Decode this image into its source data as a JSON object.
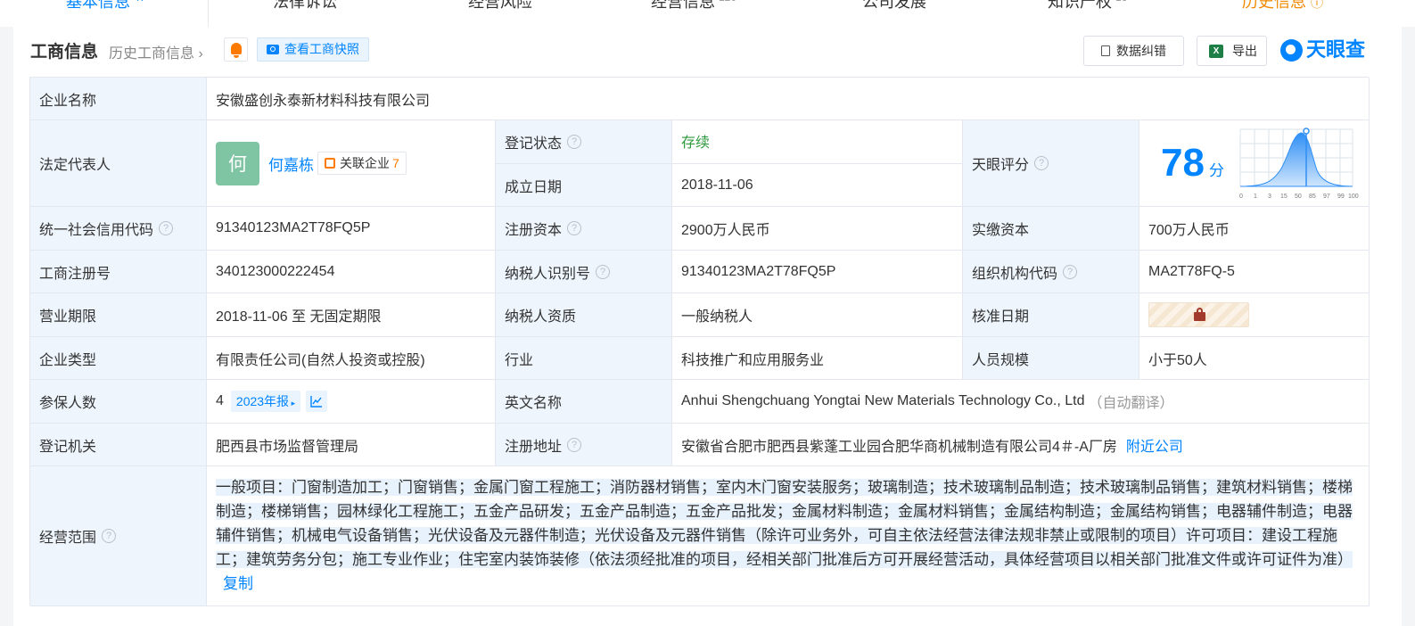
{
  "tabs": [
    {
      "label": "基本信息",
      "count": "47"
    },
    {
      "label": "法律诉讼",
      "count": ""
    },
    {
      "label": "经营风险",
      "count": ""
    },
    {
      "label": "经营信息",
      "count": "120"
    },
    {
      "label": "公司发展",
      "count": ""
    },
    {
      "label": "知识产权",
      "count": "16"
    },
    {
      "label": "历史信息",
      "count": ""
    }
  ],
  "header": {
    "title": "工商信息",
    "history_link": "历史工商信息",
    "snapshot_btn": "查看工商快照",
    "correct_btn": "数据纠错",
    "export_btn": "导出",
    "brand": "天眼查"
  },
  "rows": {
    "company_name": {
      "label": "企业名称",
      "value": "安徽盛创永泰新材料科技有限公司"
    },
    "legal_rep": {
      "label": "法定代表人",
      "avatar": "何",
      "name": "何嘉栋",
      "related_label": "关联企业",
      "related_count": "7"
    },
    "reg_status": {
      "label": "登记状态",
      "value": "存续"
    },
    "found_date": {
      "label": "成立日期",
      "value": "2018-11-06"
    },
    "score": {
      "label": "天眼评分",
      "value": "78",
      "unit": "分",
      "axis": [
        "0",
        "1",
        "3",
        "15",
        "50",
        "85",
        "97",
        "99",
        "100"
      ]
    },
    "credit_code": {
      "label": "统一社会信用代码",
      "value": "91340123MA2T78FQ5P"
    },
    "reg_capital": {
      "label": "注册资本",
      "value": "2900万人民币"
    },
    "paid_capital": {
      "label": "实缴资本",
      "value": "700万人民币"
    },
    "reg_number": {
      "label": "工商注册号",
      "value": "340123000222454"
    },
    "taxpayer_id": {
      "label": "纳税人识别号",
      "value": "91340123MA2T78FQ5P"
    },
    "org_code": {
      "label": "组织机构代码",
      "value": "MA2T78FQ-5"
    },
    "business_term": {
      "label": "营业期限",
      "value": "2018-11-06 至 无固定期限"
    },
    "taxpayer_qual": {
      "label": "纳税人资质",
      "value": "一般纳税人"
    },
    "approve_date": {
      "label": "核准日期"
    },
    "company_type": {
      "label": "企业类型",
      "value": "有限责任公司(自然人投资或控股)"
    },
    "industry": {
      "label": "行业",
      "value": "科技推广和应用服务业"
    },
    "staff_size": {
      "label": "人员规模",
      "value": "小于50人"
    },
    "insured": {
      "label": "参保人数",
      "value": "4",
      "report": "2023年报"
    },
    "english_name": {
      "label": "英文名称",
      "value": "Anhui Shengchuang Yongtai New Materials Technology Co., Ltd",
      "note": "（自动翻译）"
    },
    "reg_authority": {
      "label": "登记机关",
      "value": "肥西县市场监督管理局"
    },
    "reg_address": {
      "label": "注册地址",
      "value": "安徽省合肥市肥西县紫蓬工业园合肥华商机械制造有限公司4＃-A厂房",
      "nearby": "附近公司"
    },
    "scope": {
      "label": "经营范围",
      "value": "一般项目：门窗制造加工；门窗销售；金属门窗工程施工；消防器材销售；室内木门窗安装服务；玻璃制造；技术玻璃制品制造；技术玻璃制品销售；建筑材料销售；楼梯制造；楼梯销售；园林绿化工程施工；五金产品研发；五金产品制造；五金产品批发；金属材料制造；金属材料销售；金属结构制造；金属结构销售；电器辅件制造；电器辅件销售；机械电气设备销售；光伏设备及元器件制造；光伏设备及元器件销售（除许可业务外，可自主依法经营法律法规非禁止或限制的项目）许可项目：建设工程施工；建筑劳务分包；施工专业作业；住宅室内装饰装修（依法须经批准的项目，经相关部门批准后方可开展经营活动，具体经营项目以相关部门批准文件或许可证件为准）",
      "copy": "复制"
    }
  },
  "colors": {
    "accent": "#0084ff",
    "label_bg": "#eef5fd",
    "status_green": "#2e9a3d",
    "orange": "#ff7a00"
  }
}
